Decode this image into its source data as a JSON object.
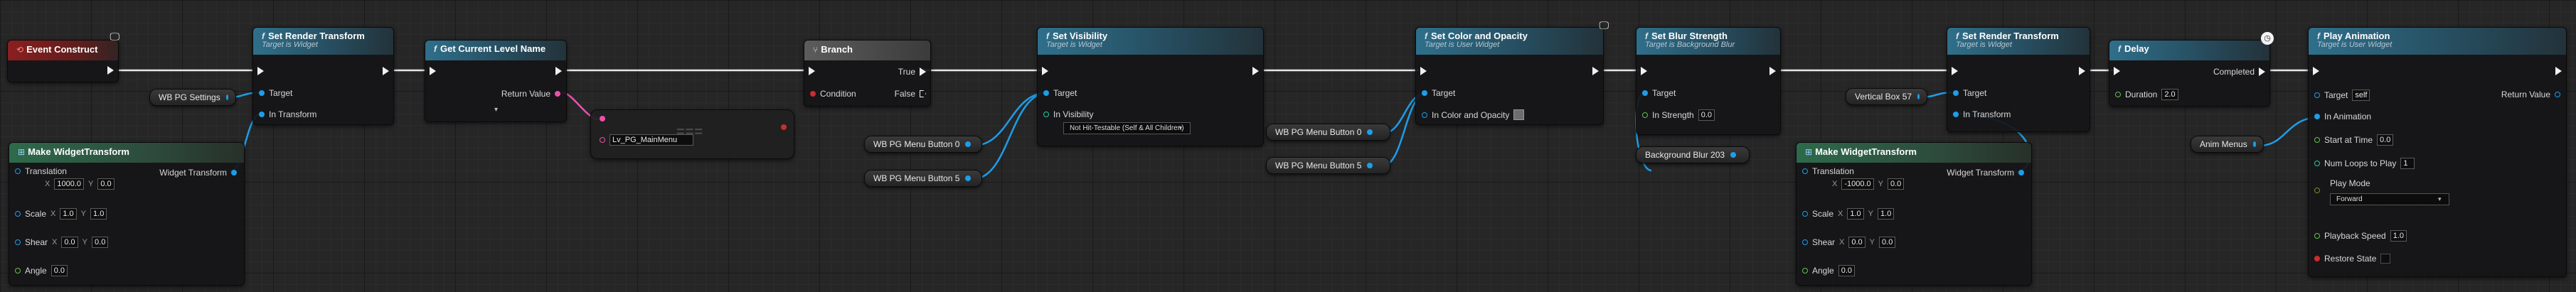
{
  "colors": {
    "exec": "#f0f0f0",
    "object": "#1e9de8",
    "float": "#62c04a",
    "string": "#f04db0",
    "bool": "#c92d2d",
    "struct": "#1e9de8"
  },
  "nodes": {
    "event_construct": {
      "title": "Event Construct"
    },
    "set_render_transform_1": {
      "title": "Set Render Transform",
      "subtitle": "Target is Widget",
      "pins": {
        "target": "Target",
        "in_transform": "In Transform"
      }
    },
    "get_level_name": {
      "title": "Get Current Level Name",
      "return_value": "Return Value"
    },
    "branch": {
      "title": "Branch",
      "condition": "Condition",
      "true_label": "True",
      "false_label": "False"
    },
    "set_visibility": {
      "title": "Set Visibility",
      "subtitle": "Target is Widget",
      "target": "Target",
      "in_visibility": "In Visibility",
      "visibility_value": "Not Hit-Testable (Self & All Children)"
    },
    "set_color_opacity": {
      "title": "Set Color and Opacity",
      "subtitle": "Target is User Widget",
      "target": "Target",
      "in_color": "In Color and Opacity"
    },
    "set_blur_strength": {
      "title": "Set Blur Strength",
      "subtitle": "Target is Background Blur",
      "target": "Target",
      "in_strength": "In Strength",
      "strength_value": "0.0"
    },
    "set_render_transform_2": {
      "title": "Set Render Transform",
      "subtitle": "Target is Widget",
      "target": "Target",
      "in_transform": "In Transform"
    },
    "delay": {
      "title": "Delay",
      "completed": "Completed",
      "duration": "Duration",
      "duration_value": "2.0"
    },
    "play_animation": {
      "title": "Play Animation",
      "subtitle": "Target is User Widget",
      "target": "Target",
      "target_value": "self",
      "return_value": "Return Value",
      "in_animation": "In Animation",
      "start_at_time": "Start at Time",
      "start_value": "0.0",
      "num_loops": "Num Loops to Play",
      "loops_value": "1",
      "play_mode": "Play Mode",
      "play_mode_value": "Forward",
      "playback_speed": "Playback Speed",
      "speed_value": "1.0",
      "restore_state": "Restore State"
    },
    "make_transform_1": {
      "title": "Make WidgetTransform",
      "translation": "Translation",
      "tx": "1000.0",
      "ty": "0.0",
      "widget_transform": "Widget Transform",
      "scale": "Scale",
      "sx": "1.0",
      "sy": "1.0",
      "shear": "Shear",
      "shx": "0.0",
      "shy": "0.0",
      "angle": "Angle",
      "angle_value": "0.0"
    },
    "make_transform_2": {
      "title": "Make WidgetTransform",
      "translation": "Translation",
      "tx": "-1000.0",
      "ty": "0.0",
      "widget_transform": "Widget Transform",
      "scale": "Scale",
      "sx": "1.0",
      "sy": "1.0",
      "shear": "Shear",
      "shx": "0.0",
      "shy": "0.0",
      "angle": "Angle",
      "angle_value": "0.0"
    },
    "equal_node": {
      "symbol": "===",
      "string_value": "Lv_PG_MainMenu"
    }
  },
  "variables": {
    "wb_pg_settings": "WB PG Settings",
    "wb_pg_menu_button_0_a": "WB PG Menu Button 0",
    "wb_pg_menu_button_5_a": "WB PG Menu Button 5",
    "wb_pg_menu_button_0_b": "WB PG Menu Button 0",
    "wb_pg_menu_button_5_b": "WB PG Menu Button 5",
    "vertical_box_57": "Vertical Box 57",
    "background_blur_203": "Background Blur 203",
    "anim_menus": "Anim Menus"
  },
  "axis": {
    "x": "X",
    "y": "Y"
  }
}
